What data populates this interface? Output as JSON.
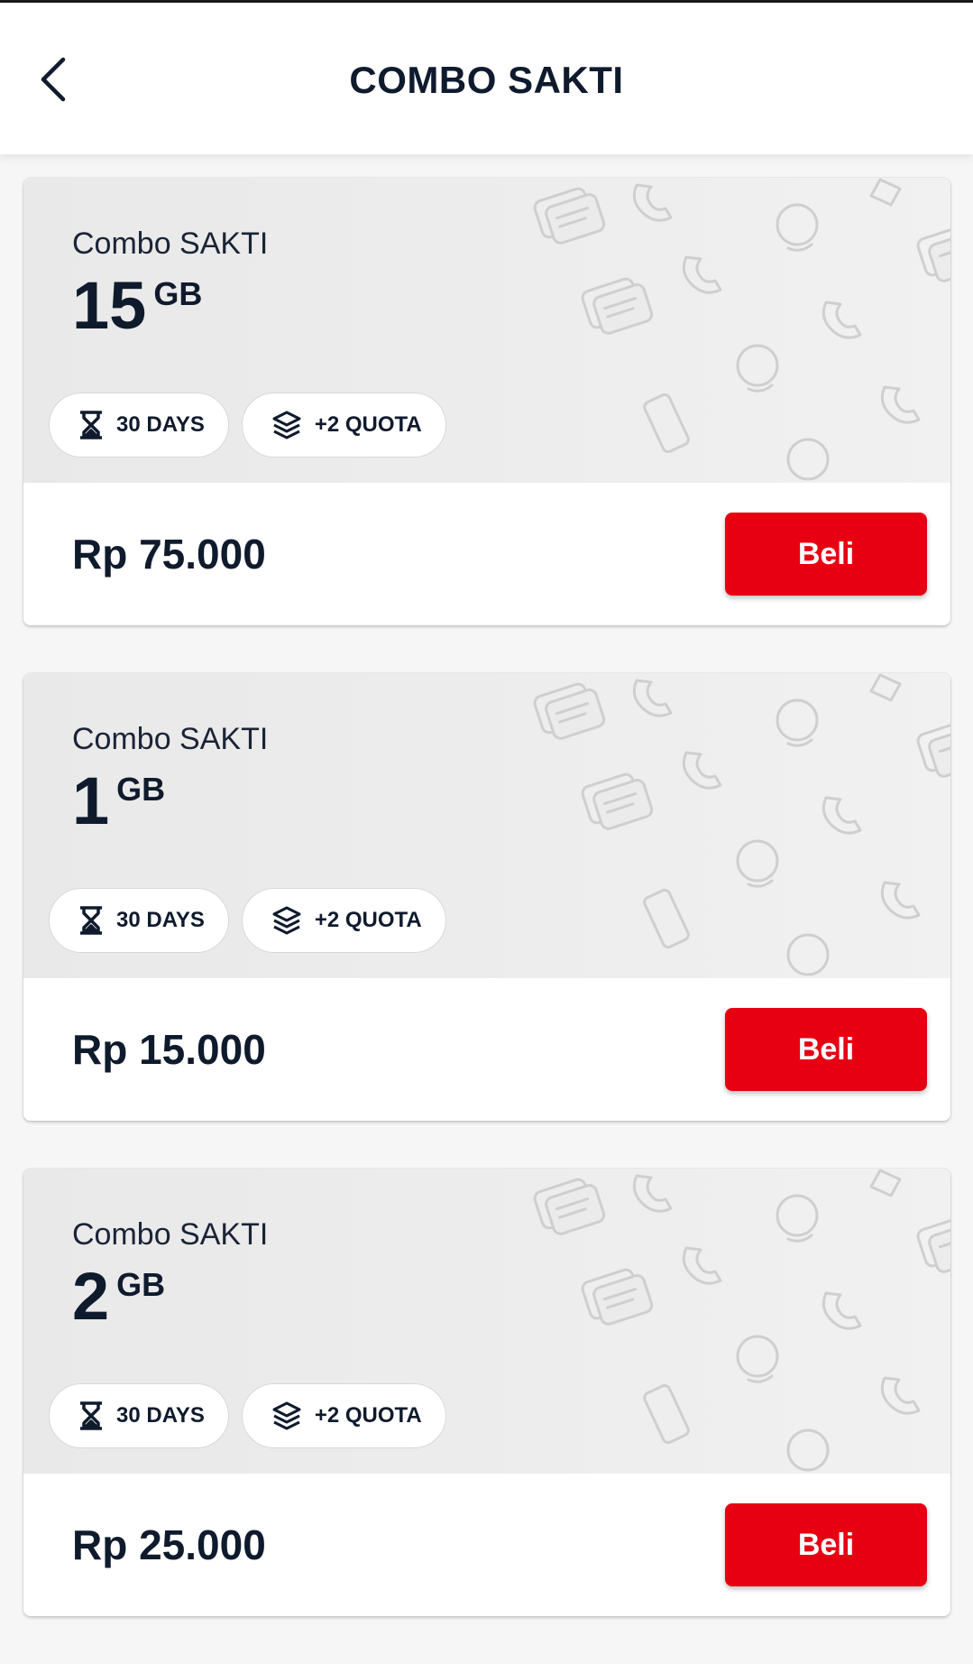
{
  "header": {
    "title": "COMBO SAKTI"
  },
  "packages": [
    {
      "name": "Combo SAKTI",
      "quota_amount": "15",
      "quota_unit": "GB",
      "validity": "30 DAYS",
      "extra": "+2 QUOTA",
      "price": "Rp 75.000",
      "buy_label": "Beli"
    },
    {
      "name": "Combo SAKTI",
      "quota_amount": "1",
      "quota_unit": "GB",
      "validity": "30 DAYS",
      "extra": "+2 QUOTA",
      "price": "Rp 15.000",
      "buy_label": "Beli"
    },
    {
      "name": "Combo SAKTI",
      "quota_amount": "2",
      "quota_unit": "GB",
      "validity": "30 DAYS",
      "extra": "+2 QUOTA",
      "price": "Rp 25.000",
      "buy_label": "Beli"
    }
  ],
  "colors": {
    "primary_red": "#e70012",
    "text_navy": "#0f1b2d"
  },
  "icons": {
    "back": "chevron-left-icon",
    "validity": "hourglass-icon",
    "extra": "layers-icon"
  }
}
